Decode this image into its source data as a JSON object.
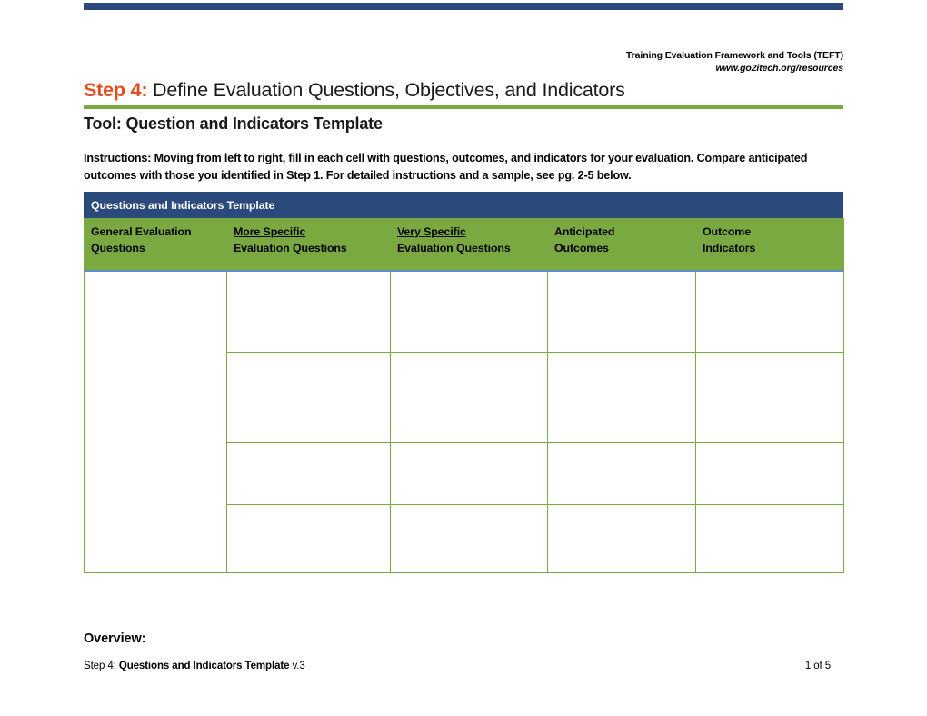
{
  "document": {
    "running_head_line1": "Training Evaluation Framework and Tools (TEFT)",
    "running_head_line2": "www.go2itech.org/resources",
    "step_label": "Step 4:",
    "step_title": " Define Evaluation Questions, Objectives, and Indicators",
    "tool_title": "Tool: Question and Indicators Template",
    "instructions": "Instructions:  Moving from left to right, fill in each cell with questions, outcomes, and indicators for your evaluation.  Compare anticipated outcomes with those you identified in Step 1.  For detailed instructions and a sample, see pg. 2-5 below.",
    "overview_heading": "Overview:"
  },
  "table": {
    "caption": "Questions and Indicators Template",
    "columns": [
      {
        "line1": "General Evaluation",
        "line2": "Questions",
        "underline_line1": false
      },
      {
        "line1": "More Specific",
        "line2": "Evaluation Questions",
        "underline_line1": true
      },
      {
        "line1": "Very Specific",
        "line2": "Evaluation Questions",
        "underline_line1": true
      },
      {
        "line1": "Anticipated",
        "line2": "Outcomes",
        "underline_line1": false
      },
      {
        "line1": "Outcome",
        "line2": "Indicators",
        "underline_line1": false
      }
    ],
    "rows": [
      {
        "c1": "",
        "c2": "",
        "c3": "",
        "c4": "",
        "c5": ""
      },
      {
        "c1": "",
        "c2": "",
        "c3": "",
        "c4": "",
        "c5": ""
      },
      {
        "c1": "",
        "c2": "",
        "c3": "",
        "c4": "",
        "c5": ""
      },
      {
        "c1": "",
        "c2": "",
        "c3": "",
        "c4": "",
        "c5": ""
      }
    ]
  },
  "footer": {
    "prefix": "Step 4: ",
    "title": "Questions and Indicators Template",
    "version": " v.3",
    "page": "1 of 5"
  },
  "colors": {
    "navy": "#2a4a7c",
    "green": "#7aa942",
    "orange": "#e04e20",
    "blue_rule": "#5b8ecb"
  }
}
